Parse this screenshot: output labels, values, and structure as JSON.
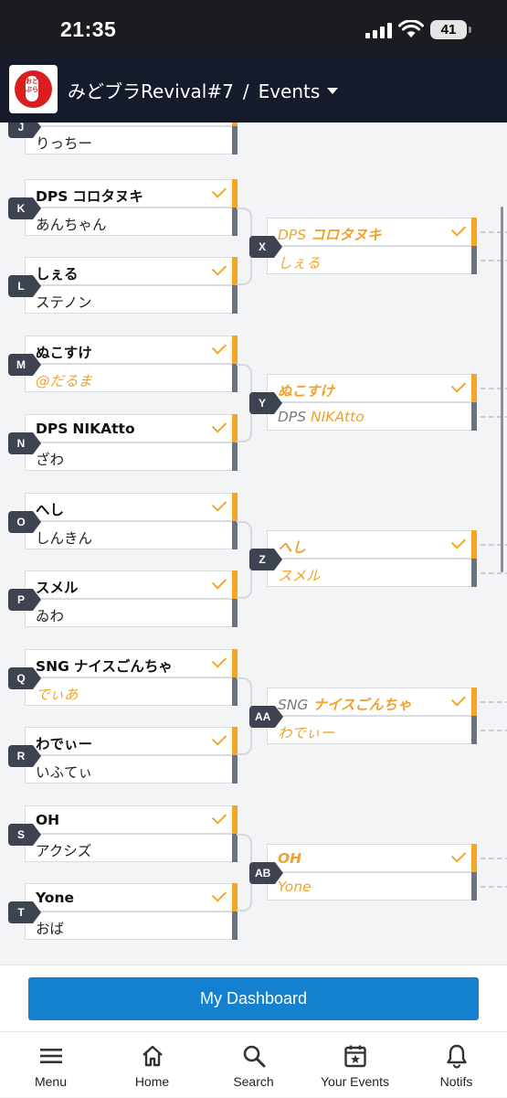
{
  "status_bar": {
    "time": "21:35",
    "battery": "41"
  },
  "header": {
    "app_title": "みどブラRevival#7",
    "separator": "/",
    "section": "Events",
    "logo_text": "おどぶら"
  },
  "bracket": {
    "round1": [
      {
        "label": "J",
        "top": {
          "name": "",
          "tag": "",
          "win": true
        },
        "bottom": {
          "name": "りっちー",
          "tag": ""
        }
      },
      {
        "label": "K",
        "top": {
          "tag": "DPS",
          "name": "コロタヌキ"
        },
        "bottom": {
          "name": "あんちゃん"
        }
      },
      {
        "label": "L",
        "top": {
          "name": "しぇる"
        },
        "bottom": {
          "name": "ステノン"
        }
      },
      {
        "label": "M",
        "top": {
          "name": "ぬこすけ"
        },
        "bottom": {
          "name": "@だるま"
        }
      },
      {
        "label": "N",
        "top": {
          "tag": "DPS",
          "name": "NIKAtto"
        },
        "bottom": {
          "name": "ざわ"
        }
      },
      {
        "label": "O",
        "top": {
          "name": "へし"
        },
        "bottom": {
          "name": "しんきん"
        }
      },
      {
        "label": "P",
        "top": {
          "name": "スメル"
        },
        "bottom": {
          "name": "ゐわ"
        }
      },
      {
        "label": "Q",
        "top": {
          "tag": "SNG",
          "name": "ナイスごんちゃ"
        },
        "bottom": {
          "name": "でぃあ"
        }
      },
      {
        "label": "R",
        "top": {
          "name": "わでぃー"
        },
        "bottom": {
          "name": "いふてぃ"
        }
      },
      {
        "label": "S",
        "top": {
          "name": "OH"
        },
        "bottom": {
          "name": "アクシズ"
        }
      },
      {
        "label": "T",
        "top": {
          "name": "Yone"
        },
        "bottom": {
          "name": "おば"
        }
      }
    ],
    "round2": [
      {
        "label": "X",
        "top": {
          "tag": "DPS",
          "name": "コロタヌキ"
        },
        "bottom": {
          "name": "しぇる"
        }
      },
      {
        "label": "Y",
        "top": {
          "name": "ぬこすけ"
        },
        "bottom": {
          "tag": "DPS",
          "name": "NIKAtto"
        }
      },
      {
        "label": "Z",
        "top": {
          "name": "へし"
        },
        "bottom": {
          "name": "スメル"
        }
      },
      {
        "label": "AA",
        "top": {
          "tag": "SNG",
          "name": "ナイスごんちゃ"
        },
        "bottom": {
          "name": "わでぃー"
        }
      },
      {
        "label": "AB",
        "top": {
          "name": "OH"
        },
        "bottom": {
          "name": "Yone"
        }
      }
    ]
  },
  "dashboard_button": "My Dashboard",
  "tabs": [
    {
      "label": "Menu",
      "icon": "menu-icon"
    },
    {
      "label": "Home",
      "icon": "home-icon"
    },
    {
      "label": "Search",
      "icon": "search-icon"
    },
    {
      "label": "Your Events",
      "icon": "calendar-star-icon"
    },
    {
      "label": "Notifs",
      "icon": "bell-icon"
    }
  ]
}
